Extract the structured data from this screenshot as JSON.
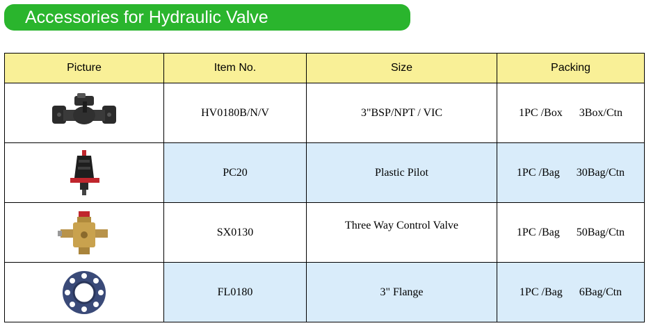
{
  "banner": {
    "title": "Accessories for Hydraulic Valve"
  },
  "table": {
    "headers": {
      "picture": "Picture",
      "item": "Item No.",
      "size": "Size",
      "packing": "Packing"
    },
    "rows": [
      {
        "picture": "hydraulic-valve-image",
        "item": "HV0180B/N/V",
        "size": "3\"BSP/NPT  / VIC",
        "pack_unit": "1PC /Box",
        "pack_ctn": "3Box/Ctn"
      },
      {
        "picture": "plastic-pilot-image",
        "item": "PC20",
        "size": "Plastic Pilot",
        "pack_unit": "1PC /Bag",
        "pack_ctn": "30Bag/Ctn"
      },
      {
        "picture": "three-way-valve-image",
        "item": "SX0130",
        "size": "Three Way Control Valve",
        "pack_unit": "1PC /Bag",
        "pack_ctn": "50Bag/Ctn"
      },
      {
        "picture": "flange-image",
        "item": "FL0180",
        "size": "3\"  Flange",
        "pack_unit": "1PC /Bag",
        "pack_ctn": "6Bag/Ctn"
      }
    ]
  },
  "colors": {
    "banner": "#2ab52d",
    "header": "#f9f097",
    "shaded_row": "#d9ecfa"
  }
}
